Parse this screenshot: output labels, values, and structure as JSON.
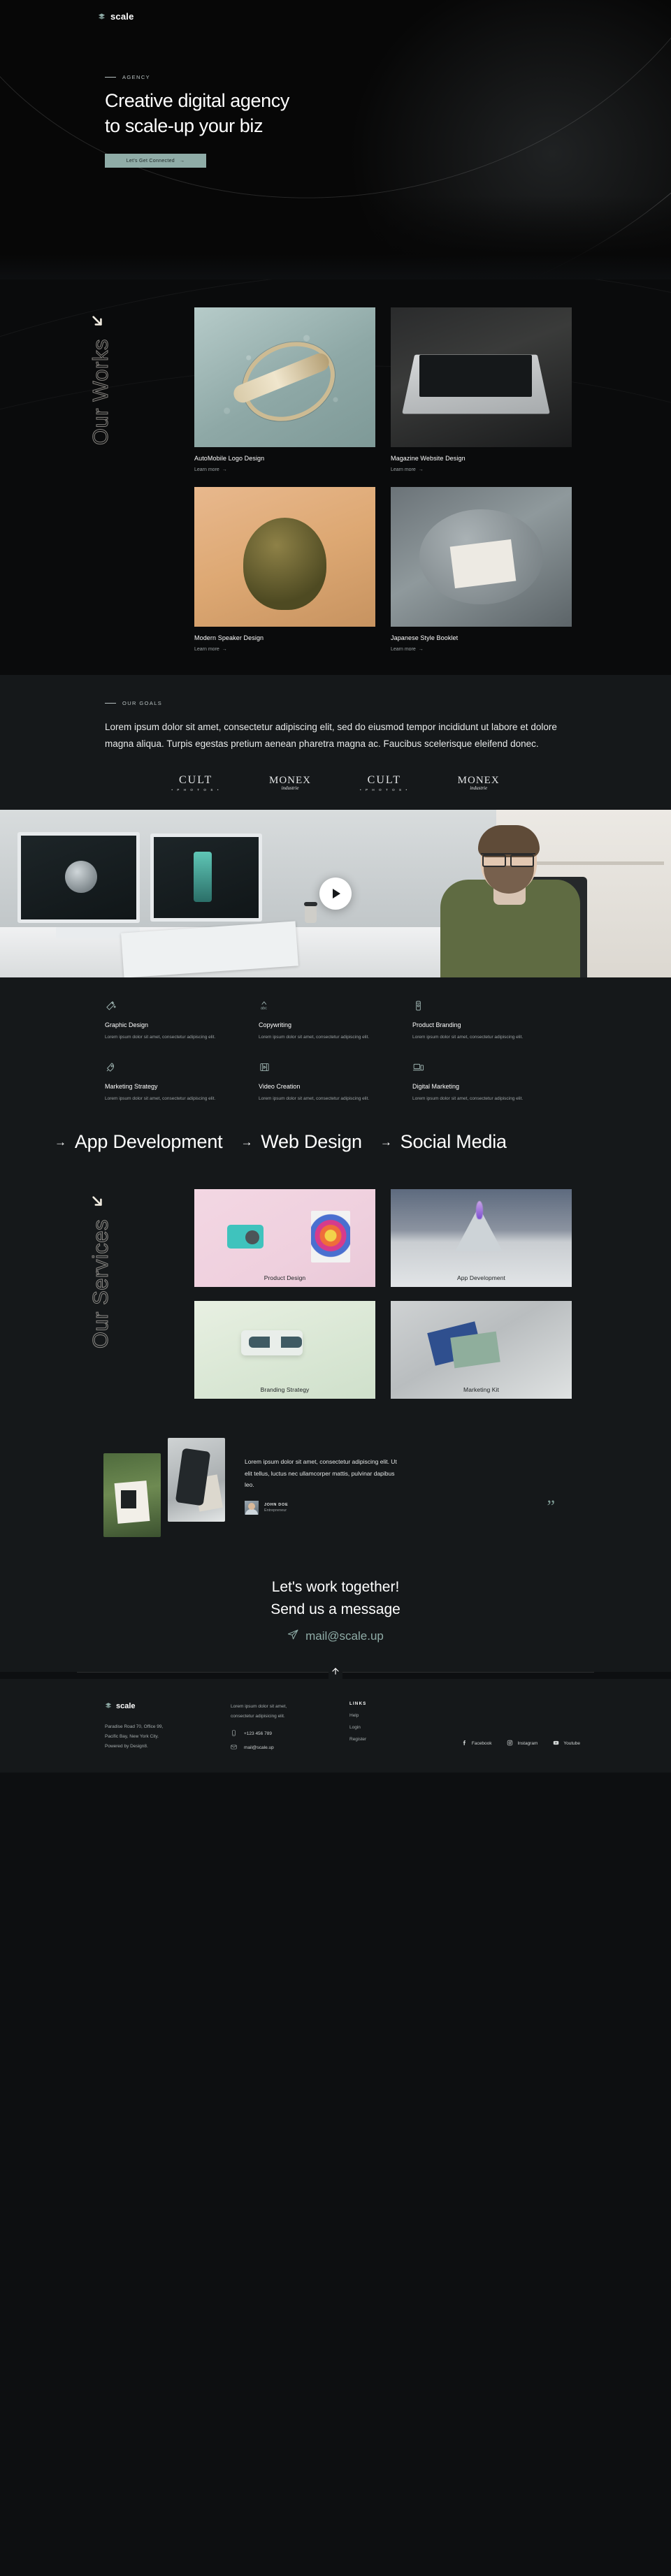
{
  "brand": {
    "name": "scale",
    "icon": "stack-icon"
  },
  "hero": {
    "eyebrow": "AGENCY",
    "heading_line1": "Creative digital agency",
    "heading_line2": "to scale-up your biz",
    "cta_label": "Let's Get Connected",
    "cta_arrow": "→",
    "accent": "#8faca7"
  },
  "works": {
    "section_word": "Our Works",
    "arrow_icon": "arrow-down-right-icon",
    "items": [
      {
        "title": "AutoMobile Logo Design",
        "link": "Learn more",
        "arrow": "→",
        "thumb": "th-auto"
      },
      {
        "title": "Magazine Website Design",
        "link": "Learn more",
        "arrow": "→",
        "thumb": "th-mag"
      },
      {
        "title": "Modern Speaker Design",
        "link": "Learn more",
        "arrow": "→",
        "thumb": "th-spk"
      },
      {
        "title": "Japanese Style Booklet",
        "link": "Learn more",
        "arrow": "→",
        "thumb": "th-jap"
      }
    ]
  },
  "goals": {
    "eyebrow": "OUR GOALS",
    "paragraph": "Lorem ipsum dolor sit amet, consectetur adipiscing elit, sed do eiusmod tempor incididunt ut labore et dolore magna aliqua. Turpis egestas pretium aenean pharetra magna ac. Faucibus scelerisque eleifend donec.",
    "logos": [
      {
        "main": "CULT",
        "sub": "• P H O T O S •",
        "style": "cult"
      },
      {
        "main": "MONEX",
        "sub": "industrie",
        "style": "monex"
      },
      {
        "main": "CULT",
        "sub": "• P H O T O S •",
        "style": "cult"
      },
      {
        "main": "MONEX",
        "sub": "industrie",
        "style": "monex"
      }
    ]
  },
  "video": {
    "play_label": "play-button"
  },
  "service_features": [
    {
      "icon": "magic-wand-icon",
      "name": "Graphic Design",
      "desc": "Lorem ipsum dolor sit amet, consectetur adipiscing elit."
    },
    {
      "icon": "abc-check-icon",
      "name": "Copywriting",
      "desc": "Lorem ipsum dolor sit amet, consectetur adipiscing elit."
    },
    {
      "icon": "cup-icon",
      "name": "Product Branding",
      "desc": "Lorem ipsum dolor sit amet, consectetur adipiscing elit."
    },
    {
      "icon": "rocket-icon",
      "name": "Marketing Strategy",
      "desc": "Lorem ipsum dolor sit amet, consectetur adipiscing elit."
    },
    {
      "icon": "film-icon",
      "name": "Video Creation",
      "desc": "Lorem ipsum dolor sit amet, consectetur adipiscing elit."
    },
    {
      "icon": "devices-icon",
      "name": "Digital Marketing",
      "desc": "Lorem ipsum dolor sit amet, consectetur adipiscing elit."
    }
  ],
  "marquee": {
    "arrow": "→",
    "items": [
      "App Development",
      "Web Design",
      "Social Media"
    ]
  },
  "services": {
    "section_word": "Our Services",
    "arrow_icon": "arrow-down-right-icon",
    "cards": [
      {
        "label": "Product Design",
        "art": "sc-product"
      },
      {
        "label": "App Development",
        "art": "sc-app"
      },
      {
        "label": "Branding Strategy",
        "art": "sc-brand"
      },
      {
        "label": "Marketing Kit",
        "art": "sc-kit"
      }
    ]
  },
  "testimonial": {
    "quote": "Lorem ipsum dolor sit amet, consectetur adipiscing elit. Ut elit tellus, luctus nec ullamcorper mattis, pulvinar dapibus leo.",
    "name": "JOHN DOE",
    "role": "Entrepreneur",
    "quote_mark": "”"
  },
  "cta": {
    "line1": "Let's work together!",
    "line2": "Send us a message",
    "email": "mail@scale.up",
    "send_icon": "paper-plane-icon"
  },
  "footer": {
    "to_top_icon": "arrow-up-icon",
    "brand": "scale",
    "address_line1": "Paradise Road 70, Office 99,",
    "address_line2": "Pacific Bay, New York City.",
    "address_line3": "Powered by Design8.",
    "lorem_line1": "Lorem ipsum dolor sit amet,",
    "lorem_line2": "consectetur adipisicing elit.",
    "phone": "+123 456 789",
    "email": "mail@scale.up",
    "links_heading": "LINKS",
    "links": [
      "Help",
      "Login",
      "Register"
    ],
    "socials": [
      {
        "icon": "facebook-icon",
        "label": "Facebook"
      },
      {
        "icon": "instagram-icon",
        "label": "Instagram"
      },
      {
        "icon": "youtube-icon",
        "label": "Youtube"
      }
    ]
  }
}
